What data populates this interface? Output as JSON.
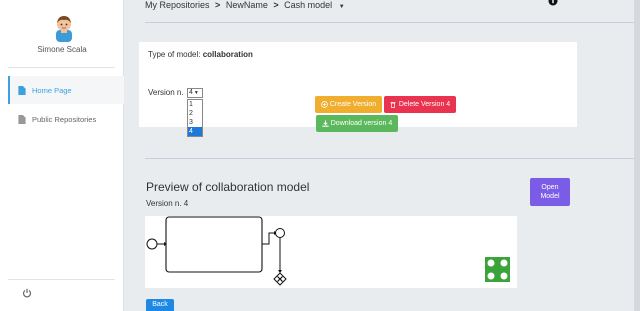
{
  "user": {
    "name": "Simone Scala"
  },
  "sidebar": {
    "items": [
      {
        "label": "Home Page",
        "icon": "file-icon"
      },
      {
        "label": "Public Repositories",
        "icon": "file-icon"
      }
    ]
  },
  "breadcrumb": {
    "items": [
      "My Repositories",
      "NewName",
      "Cash model"
    ],
    "separator": ">"
  },
  "model": {
    "type_label": "Type of model:",
    "type_value": "collaboration",
    "version_label": "Version n.",
    "version_selected": "4",
    "version_options": [
      "1",
      "2",
      "3",
      "4"
    ]
  },
  "buttons": {
    "create": "Create Version",
    "delete": "Delete Version 4",
    "download": "Download version 4",
    "open_line1": "Open",
    "open_line2": "Model",
    "bottom": "Back"
  },
  "preview": {
    "title": "Preview of collaboration model",
    "version": "Version n. 4"
  },
  "colors": {
    "accent": "#3da0e0",
    "create": "#f0ad2e",
    "delete": "#e9334f",
    "download": "#5cb85c",
    "open": "#7b5ce6",
    "logo": "#3aa33a"
  }
}
